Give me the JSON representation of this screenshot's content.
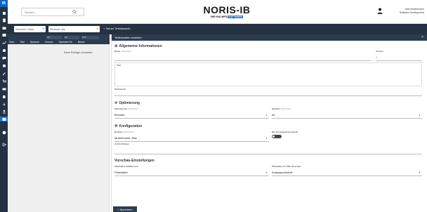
{
  "app": {
    "logo": "IB"
  },
  "header": {
    "search_placeholder": "Suchen...",
    "brand_name": "NORIS-IB",
    "brand_tagline_a": "WIR MACHEN",
    "brand_tagline_b": "SOFTWARE",
    "user_name": "Max Mustermann",
    "user_role": "Software Development"
  },
  "toolbar": {
    "filter1": "Versionen: Stabi...",
    "filter2": "Stichwort: alle",
    "new_text": "Neuer Textbaustein"
  },
  "table": {
    "filters": [
      "Ale",
      "Ale",
      "PSF"
    ],
    "columns": [
      "Hom",
      "Titel",
      "Sprache",
      "Version",
      "Optimiert für",
      "Besch"
    ],
    "empty": "Keine Einträge vorhanden"
  },
  "panel": {
    "title": "Textbaustein erstellen",
    "sec_general": "Allgemeine Informationen",
    "name_label": "Name",
    "name_hint": "(Pflichtfeld)",
    "version_label": "Version",
    "version_value": "0",
    "title_label": "Titel",
    "keyword_label": "Stichworter",
    "sec_opt": "Optimierung",
    "optfor_label": "Optimiert für",
    "optfor_hint": "(Pflichtfeld)",
    "optfor_value": "Browser",
    "lang_label": "Sprache",
    "lang_hint": "(Pflichtfeld)",
    "lang_value": "de",
    "sec_conf": "Konfiguration",
    "editor_label": "Besitzer",
    "editor_hint": "(Pflichtfeld)",
    "editor_value": "Mustermann, Max",
    "result_label": "Nur für Ereignisprotokolle",
    "notes_label": "Archiv Notizen",
    "sec_preview": "Vorschau-Einstellungen",
    "pv1_label": "Platzhalter befüllen aus",
    "pv1_value": "Platzhalter",
    "pv2_label": "Platzhalter für PDF-Vorschau",
    "pv2_value": "Analyseprotokoll",
    "save": "Speichern"
  },
  "colors": {
    "rail": "#243243",
    "accent": "#1976d2",
    "bar": "#2c3c4e"
  }
}
